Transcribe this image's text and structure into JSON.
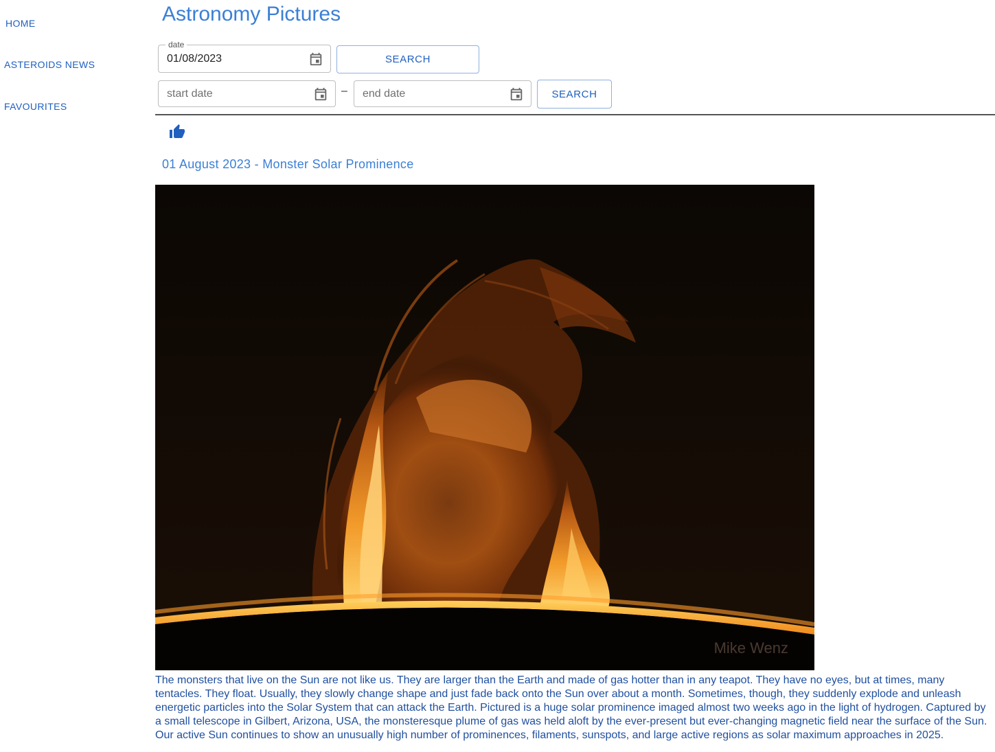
{
  "nav": {
    "home": "HOME",
    "asteroids_news": "ASTEROIDS NEWS",
    "favourites": "FAVOURITES"
  },
  "header": {
    "title": "Astronomy Pictures"
  },
  "single_search": {
    "date_label": "date",
    "date_value": "01/08/2023",
    "button": "SEARCH"
  },
  "range_search": {
    "start_placeholder": "start date",
    "separator": "–",
    "end_placeholder": "end date",
    "button": "SEARCH"
  },
  "apod": {
    "title": "01 August 2023 - Monster Solar Prominence",
    "image_credit": "Mike Wenz",
    "explanation": "The monsters that live on the Sun are not like us. They are larger than the Earth and made of gas hotter than in any teapot. They have no eyes, but at times, many tentacles. They float. Usually, they slowly change shape and just fade back onto the Sun over about a month. Sometimes, though, they suddenly explode and unleash energetic particles into the Solar System that can attack the Earth.  Pictured is a huge solar prominence imaged almost two weeks ago in the light of hydrogen. Captured by a small telescope in Gilbert, Arizona, USA, the monsteresque plume of gas was held aloft by the ever-present but ever-changing magnetic field near the surface of the Sun. Our active Sun continues to show an unusually high number of prominences, filaments, sunspots, and large active regions as solar maximum approaches in 2025."
  },
  "icons": {
    "calendar": "calendar-icon",
    "like": "thumb-up-icon"
  },
  "colors": {
    "accent": "#3b7fd6",
    "link": "#1f5fbf",
    "text": "#1f4f9f"
  }
}
